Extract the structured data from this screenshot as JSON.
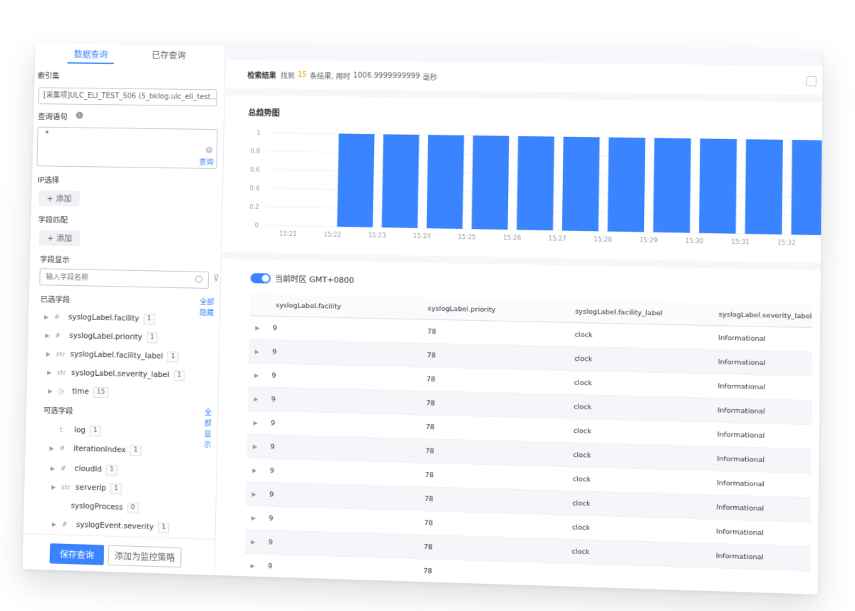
{
  "tabs": [
    "数据查询",
    "已存查询"
  ],
  "index_set": {
    "label": "索引集",
    "value": "[采集项]ULC_ELI_TEST_506 (5_bklog.ulc_eli_test..."
  },
  "query": {
    "label": "查询语句",
    "value": "*",
    "run_link": "查询"
  },
  "ip_select": {
    "label": "IP选择",
    "add": "添加"
  },
  "field_match": {
    "label": "字段匹配",
    "add": "添加"
  },
  "field_display": {
    "label": "字段显示",
    "placeholder": "输入字段名称"
  },
  "selected_fields": {
    "label": "已选字段",
    "action": "全部隐藏",
    "items": [
      {
        "type": "#",
        "name": "syslogLabel.facility",
        "count": "1"
      },
      {
        "type": "#",
        "name": "syslogLabel.priority",
        "count": "1"
      },
      {
        "type": "str",
        "name": "syslogLabel.facility_label",
        "count": "1"
      },
      {
        "type": "str",
        "name": "syslogLabel.severity_label",
        "count": "1"
      },
      {
        "type": "clock",
        "name": "time",
        "count": "15"
      }
    ]
  },
  "optional_fields": {
    "label": "可选字段",
    "action": "全部显示",
    "items": [
      {
        "type": "t",
        "name": "log",
        "count": "1"
      },
      {
        "type": "#",
        "name": "iterationIndex",
        "count": "1"
      },
      {
        "type": "#",
        "name": "cloudId",
        "count": "1"
      },
      {
        "type": "str",
        "name": "serverIp",
        "count": "1"
      },
      {
        "type": "",
        "name": "syslogProcess",
        "count": "0"
      },
      {
        "type": "#",
        "name": "syslogEvent.severity",
        "count": "1"
      }
    ]
  },
  "footer": {
    "save": "保存查询",
    "monitor": "添加为监控策略"
  },
  "result": {
    "title": "检索结果",
    "prefix": "找到",
    "count": "15",
    "suffix": "条结果, 用时",
    "time": "1006.9999999999",
    "unit": "毫秒"
  },
  "chart_data": {
    "type": "bar",
    "title": "总趋势图",
    "categories": [
      "15:21",
      "15:22",
      "15:23",
      "15:24",
      "15:25",
      "15:26",
      "15:27",
      "15:28",
      "15:29",
      "15:30",
      "15:31",
      "15:32"
    ],
    "values": [
      0,
      1,
      1,
      1,
      1,
      1,
      1,
      1,
      1,
      1,
      1,
      1
    ],
    "ylim": [
      0,
      1
    ],
    "yticks": [
      "0",
      "0.2",
      "0.4",
      "0.6",
      "0.8",
      "1"
    ],
    "color": "#3a84ff"
  },
  "timezone": {
    "label": "当前时区 GMT+0800"
  },
  "table": {
    "columns": [
      "syslogLabel.facility",
      "syslogLabel.priority",
      "syslogLabel.facility_label",
      "syslogLabel.severity_label"
    ],
    "rows": [
      [
        "9",
        "78",
        "clock",
        "Informational"
      ],
      [
        "9",
        "78",
        "clock",
        "Informational"
      ],
      [
        "9",
        "78",
        "clock",
        "Informational"
      ],
      [
        "9",
        "78",
        "clock",
        "Informational"
      ],
      [
        "9",
        "78",
        "clock",
        "Informational"
      ],
      [
        "9",
        "78",
        "clock",
        "Informational"
      ],
      [
        "9",
        "78",
        "clock",
        "Informational"
      ],
      [
        "9",
        "78",
        "clock",
        "Informational"
      ],
      [
        "9",
        "78",
        "clock",
        "Informational"
      ],
      [
        "9",
        "78",
        "clock",
        "Informational"
      ],
      [
        "9",
        "78",
        "",
        ""
      ]
    ]
  }
}
